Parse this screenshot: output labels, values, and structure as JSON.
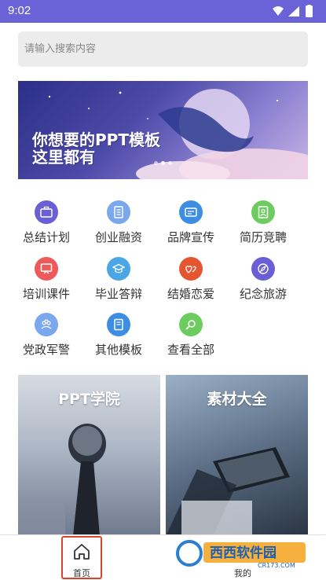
{
  "status_bar": {
    "time": "9:02",
    "background_color": "#6a63d8",
    "icons": [
      "wifi-icon",
      "signal-icon",
      "battery-icon"
    ]
  },
  "search": {
    "placeholder": "请输入搜索内容"
  },
  "banner": {
    "line1": "你想要的PPT模板",
    "line2": "这里都有",
    "dots_count": 3,
    "active_dot": 1
  },
  "categories": [
    {
      "label": "总结计划",
      "icon": "briefcase-icon",
      "color": "#6b5fd8"
    },
    {
      "label": "创业融资",
      "icon": "document-icon",
      "color": "#7ba7ee"
    },
    {
      "label": "品牌宣传",
      "icon": "id-card-icon",
      "color": "#3d8ee3"
    },
    {
      "label": "简历竞聘",
      "icon": "resume-icon",
      "color": "#6dcc5f"
    },
    {
      "label": "培训课件",
      "icon": "presentation-icon",
      "color": "#ee5a5a"
    },
    {
      "label": "毕业答辩",
      "icon": "graduation-cap-icon",
      "color": "#4aa6e6"
    },
    {
      "label": "结婚恋爱",
      "icon": "hearts-icon",
      "color": "#e5552f"
    },
    {
      "label": "纪念旅游",
      "icon": "compass-icon",
      "color": "#6b5fd8"
    },
    {
      "label": "党政军警",
      "icon": "people-icon",
      "color": "#7ba7ee"
    },
    {
      "label": "其他模板",
      "icon": "book-icon",
      "color": "#3d8ee3"
    },
    {
      "label": "查看全部",
      "icon": "search-circle-icon",
      "color": "#6dcc5f"
    }
  ],
  "cards": [
    {
      "title": "PPT学院"
    },
    {
      "title": "素材大全"
    }
  ],
  "bottom_nav": {
    "home_label": "首页",
    "mine_label": "我的",
    "highlight_color": "#d9452b"
  },
  "watermark": {
    "brand": "西西软件园",
    "domain": "CR173.COM"
  }
}
